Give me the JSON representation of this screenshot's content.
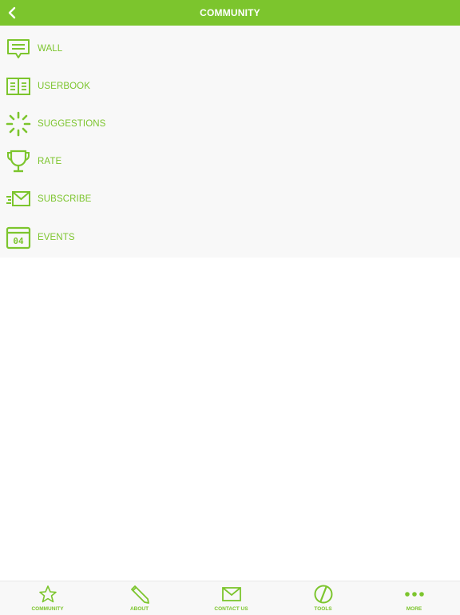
{
  "header": {
    "title": "COMMUNITY",
    "back_icon": "chevron-left-icon"
  },
  "menu": {
    "items": [
      {
        "label": "WALL",
        "icon": "chat-bubble-icon"
      },
      {
        "label": "USERBOOK",
        "icon": "open-book-icon"
      },
      {
        "label": "SUGGESTIONS",
        "icon": "loading-spinner-icon"
      },
      {
        "label": "RATE",
        "icon": "trophy-icon"
      },
      {
        "label": "SUBSCRIBE",
        "icon": "fast-mail-icon"
      },
      {
        "label": "EVENTS",
        "icon": "calendar-icon",
        "calendar_day": "04"
      }
    ]
  },
  "tabbar": {
    "tabs": [
      {
        "label": "COMMUNITY",
        "icon": "star-icon"
      },
      {
        "label": "ABOUT",
        "icon": "pencil-icon"
      },
      {
        "label": "CONTACT US",
        "icon": "envelope-icon"
      },
      {
        "label": "TOOLS",
        "icon": "slash-circle-icon"
      },
      {
        "label": "MORE",
        "icon": "more-dots-icon"
      }
    ]
  },
  "colors": {
    "accent": "#7cc52d",
    "menu_background": "#f8f8f8",
    "page_background": "#ffffff"
  }
}
